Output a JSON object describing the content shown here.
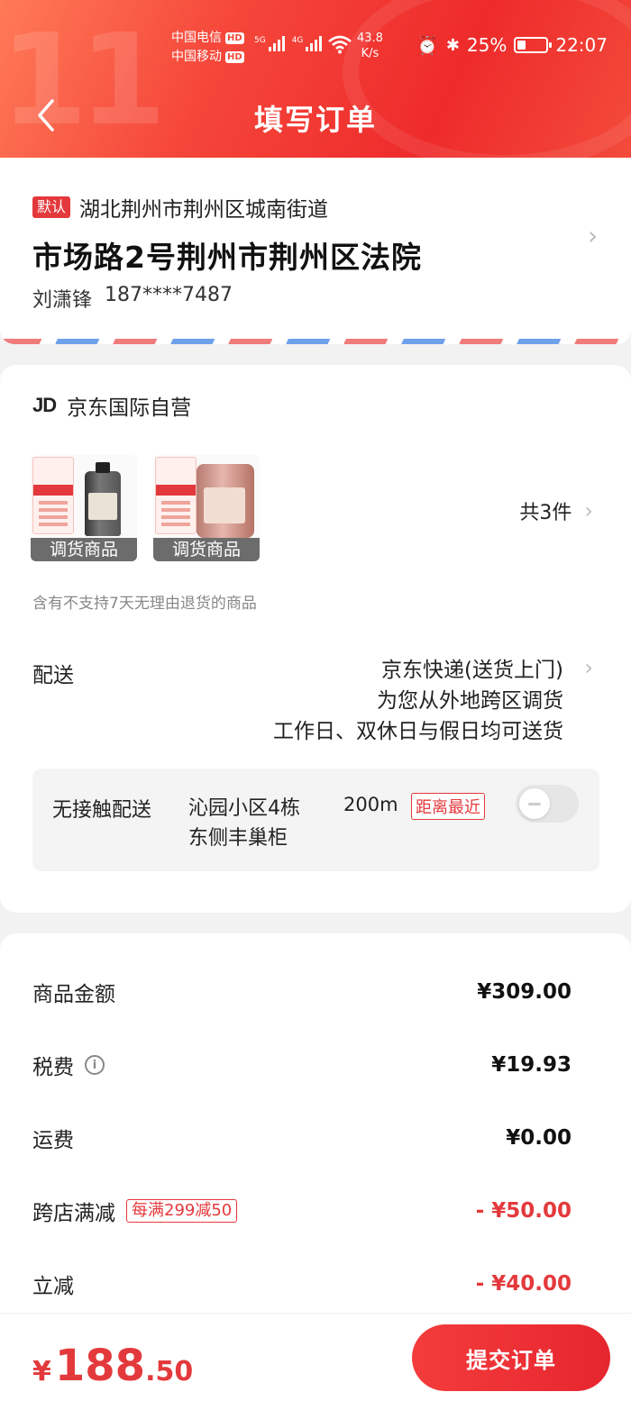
{
  "status_bar": {
    "carrier1": "中国电信",
    "carrier2": "中国移动",
    "hd": "HD",
    "net1": "5G",
    "net2": "4G",
    "speed_value": "43.8",
    "speed_unit": "K/s",
    "battery": "25%",
    "time": "22:07"
  },
  "header": {
    "title": "填写订单",
    "deco_text": "11"
  },
  "address": {
    "default_tag": "默认",
    "region": "湖北荆州市荆州区城南街道",
    "detail": "市场路2号荆州市荆州区法院",
    "name": "刘潇锋",
    "phone": "187****7487"
  },
  "shop": {
    "logo": "JD",
    "name": "京东国际自营",
    "products": [
      {
        "caption": "调货商品",
        "icon": "motor-oil-bottle"
      },
      {
        "caption": "调货商品",
        "icon": "motor-oil-can"
      }
    ],
    "count": "共3件",
    "notice": "含有不支持7天无理由退货的商品",
    "delivery_label": "配送",
    "delivery_lines": [
      "京东快递(送货上门)",
      "为您从外地跨区调货",
      "工作日、双休日与假日均可送货"
    ],
    "contactless": {
      "label": "无接触配送",
      "place_line1": "沁园小区4栋",
      "place_line2": "东侧丰巢柜",
      "distance": "200m",
      "tag": "距离最近",
      "enabled": false
    }
  },
  "prices": {
    "rows": [
      {
        "label": "商品金额",
        "value": "¥309.00"
      },
      {
        "label": "税费",
        "value": "¥19.93"
      },
      {
        "label": "运费",
        "value": "¥0.00"
      },
      {
        "label": "跨店满减",
        "value": "- ¥50.00",
        "tag": "每满299减50"
      },
      {
        "label": "立减",
        "value": "- ¥40.00"
      }
    ]
  },
  "footer": {
    "currency": "¥",
    "total_int": "188",
    "total_dec": ".50",
    "submit_label": "提交订单"
  },
  "colors": {
    "brand_red": "#e4393c",
    "header_gradient_start": "#ff7a57",
    "header_gradient_end": "#ee2b2b"
  }
}
